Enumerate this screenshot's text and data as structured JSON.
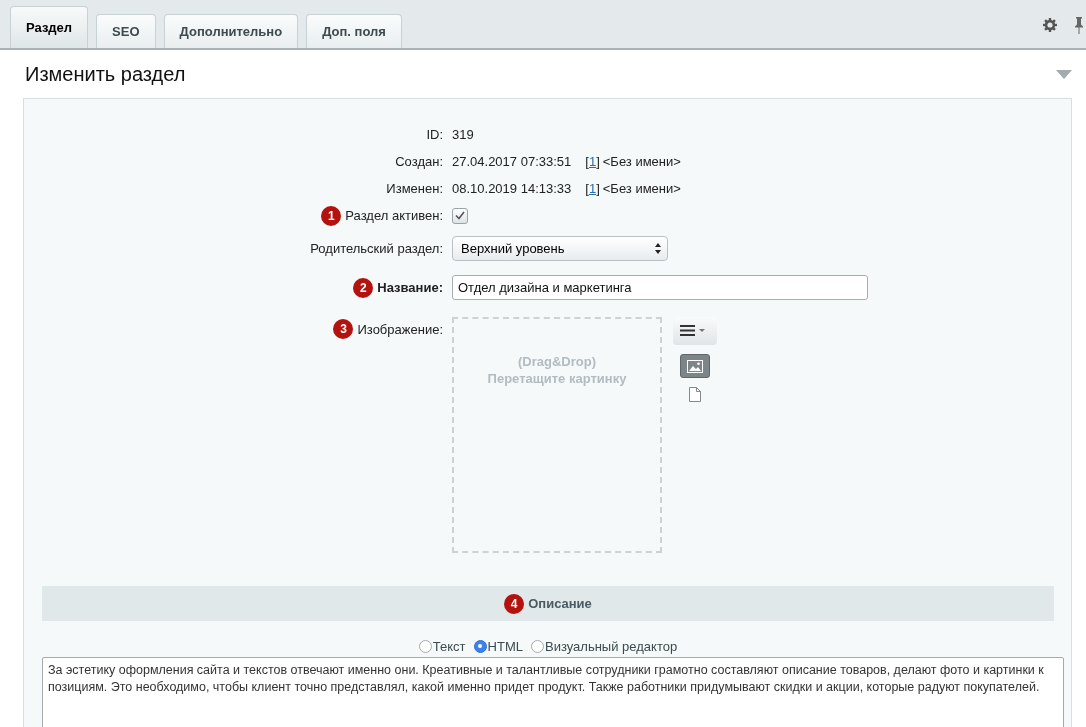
{
  "tabs": [
    {
      "label": "Раздел",
      "selected": true
    },
    {
      "label": "SEO",
      "selected": false
    },
    {
      "label": "Дополнительно",
      "selected": false
    },
    {
      "label": "Доп. поля",
      "selected": false
    }
  ],
  "title": "Изменить раздел",
  "info": [
    {
      "label": "ID:",
      "value": "319"
    },
    {
      "label": "Создан:",
      "value": "27.04.2017 07:33:51",
      "user_ref": {
        "before": "[",
        "link": "1",
        "after": "]"
      },
      "user_name": "<Без имени>"
    },
    {
      "label": "Изменен:",
      "value": "08.10.2019 14:13:33",
      "user_ref": {
        "before": "[",
        "link": "1",
        "after": "]"
      },
      "user_name": "<Без имени>"
    }
  ],
  "fields": [
    {
      "kind": "checkbox",
      "badge": "1",
      "label": "Раздел активен:",
      "checked": true
    },
    {
      "kind": "select",
      "label": "Родительский раздел:",
      "value": "Верхний уровень"
    },
    {
      "kind": "text",
      "badge": "2",
      "label": "Название:",
      "required": true,
      "value": "Отдел дизайна и маркетинга"
    },
    {
      "kind": "image",
      "badge": "3",
      "label": "Изображение:",
      "drop_hint": [
        "(Drag&Drop)",
        "Перетащите картинку"
      ]
    }
  ],
  "description": {
    "badge": "4",
    "heading": "Описание",
    "modes": [
      {
        "label": "Текст",
        "selected": false
      },
      {
        "label": "HTML",
        "selected": true
      },
      {
        "label": "Визуальный редактор",
        "selected": false
      }
    ],
    "text": "За эстетику оформления сайта и текстов отвечают именно они. Креативные и талантливые сотрудники грамотно составляют описание товаров, делают фото и картинки к позициям. Это необходимо, чтобы клиент точно представлял, какой именно придет продукт. Также работники придумывают скидки и акции, которые радуют покупателей."
  }
}
